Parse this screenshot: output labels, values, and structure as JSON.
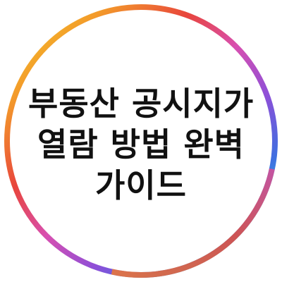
{
  "title_lines": [
    "부동산 공시지가",
    "열람 방법 완벽",
    "가이드"
  ],
  "ring_colors": [
    "#e8453c",
    "#f39a2a",
    "#f2dc28",
    "#5fd04a",
    "#2fb6e0",
    "#3f6fe0",
    "#8e4fd8",
    "#d84fb0"
  ],
  "text_color": "#111111",
  "background_color": "#ffffff"
}
